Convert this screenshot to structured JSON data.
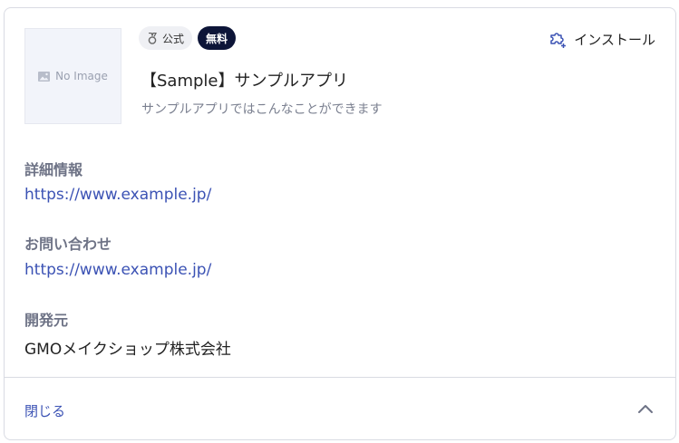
{
  "thumbnail": {
    "placeholder": "No Image"
  },
  "badges": {
    "official": "公式",
    "free": "無料"
  },
  "install": {
    "label": "インストール"
  },
  "app": {
    "name": "【Sample】サンプルアプリ",
    "description": "サンプルアプリではこんなことができます"
  },
  "details": {
    "info_label": "詳細情報",
    "info_link": "https://www.example.jp/",
    "contact_label": "お問い合わせ",
    "contact_link": "https://www.example.jp/",
    "developer_label": "開発元",
    "developer_value": "GMOメイクショップ株式会社"
  },
  "footer": {
    "close_label": "閉じる"
  },
  "colors": {
    "accent": "#3b52b4",
    "badge_dark": "#0d1538",
    "label_gray": "#6e7386",
    "border": "#d9dbe3"
  },
  "icons": {
    "install": "puzzle-plus-icon",
    "official": "medal-icon",
    "collapse": "chevron-up-icon",
    "thumbnail": "image-icon"
  }
}
